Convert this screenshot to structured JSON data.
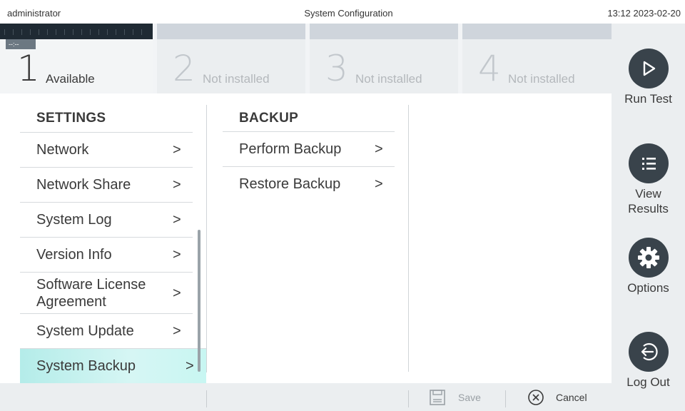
{
  "topbar": {
    "user": "administrator",
    "title": "System Configuration",
    "clock": "13:12 2023-02-20"
  },
  "modules": [
    {
      "number": "1",
      "status": "Available",
      "indicator": "--:--"
    },
    {
      "number": "2",
      "status": "Not installed"
    },
    {
      "number": "3",
      "status": "Not installed"
    },
    {
      "number": "4",
      "status": "Not installed"
    }
  ],
  "rightnav": {
    "run_test": "Run Test",
    "view_results_1": "View",
    "view_results_2": "Results",
    "options": "Options",
    "log_out": "Log Out"
  },
  "settings": {
    "heading": "SETTINGS",
    "items": [
      {
        "label": "Network"
      },
      {
        "label": "Network Share"
      },
      {
        "label": "System Log"
      },
      {
        "label": "Version Info"
      },
      {
        "label_1": "Software License",
        "label_2": "Agreement"
      },
      {
        "label": "System Update"
      },
      {
        "label": "System Backup",
        "selected": true
      }
    ]
  },
  "backup": {
    "heading": "BACKUP",
    "items": [
      {
        "label": "Perform Backup"
      },
      {
        "label": "Restore Backup"
      }
    ]
  },
  "footer": {
    "save": "Save",
    "cancel": "Cancel"
  },
  "colors": {
    "selected_row": "#c8f6f2",
    "nav_button": "#39434b",
    "panel_bg": "#ebeef0"
  }
}
